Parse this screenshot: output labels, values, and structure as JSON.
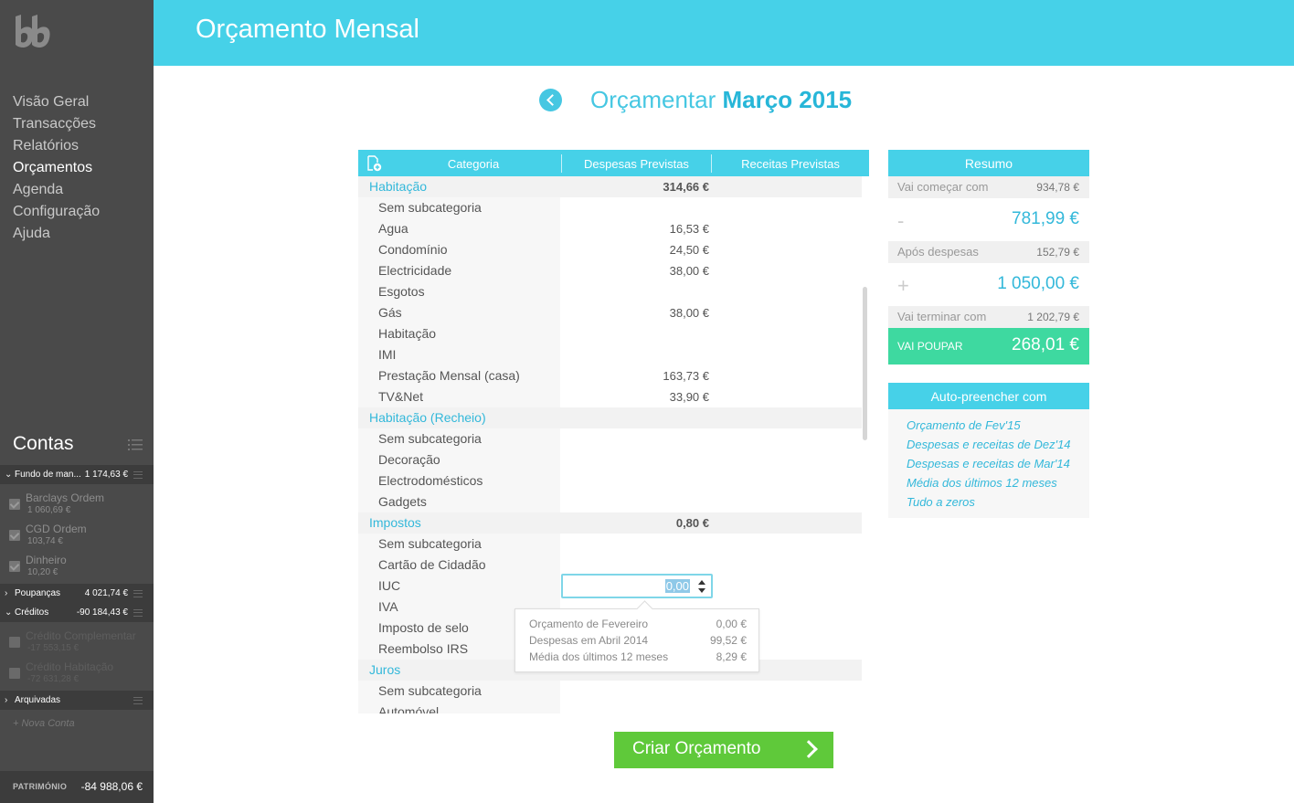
{
  "sidebar": {
    "nav": [
      "Visão Geral",
      "Transacções",
      "Relatórios",
      "Orçamentos",
      "Agenda",
      "Configuração",
      "Ajuda"
    ],
    "active_nav": "Orçamentos",
    "contas_title": "Contas",
    "groups": {
      "fundo": {
        "name": "Fundo de man...",
        "value": "1 174,63 €"
      },
      "poupancas": {
        "name": "Poupanças",
        "value": "4 021,74 €"
      },
      "creditos": {
        "name": "Créditos",
        "value": "-90 184,43 €"
      },
      "arquivadas": {
        "name": "Arquivadas"
      }
    },
    "fundo_accounts": [
      {
        "name": "Barclays Ordem",
        "value": "1 060,69 €"
      },
      {
        "name": "CGD Ordem",
        "value": "103,74 €"
      },
      {
        "name": "Dinheiro",
        "value": "10,20 €"
      }
    ],
    "credito_accounts": [
      {
        "name": "Crédito Complementar",
        "value": "-17 553,15 €"
      },
      {
        "name": "Crédito Habitação",
        "value": "-72 631,28 €"
      }
    ],
    "nova_conta": "+ Nova Conta",
    "patrimonio_label": "PATRIMÓNIO",
    "patrimonio_value": "-84 988,06 €"
  },
  "header": {
    "title": "Orçamento Mensal"
  },
  "month": {
    "prefix": "Orçamentar",
    "name": "Março 2015"
  },
  "table": {
    "headers": {
      "categoria": "Categoria",
      "despesas": "Despesas Previstas",
      "receitas": "Receitas Previstas"
    },
    "rows": [
      {
        "type": "cat",
        "name": "Habitação",
        "amount": "314,66 €"
      },
      {
        "type": "sub",
        "name": "Sem subcategoria",
        "amount": ""
      },
      {
        "type": "sub",
        "name": "Agua",
        "amount": "16,53 €"
      },
      {
        "type": "sub",
        "name": "Condomínio",
        "amount": "24,50 €"
      },
      {
        "type": "sub",
        "name": "Electricidade",
        "amount": "38,00 €"
      },
      {
        "type": "sub",
        "name": "Esgotos",
        "amount": ""
      },
      {
        "type": "sub",
        "name": "Gás",
        "amount": "38,00 €"
      },
      {
        "type": "sub",
        "name": "Habitação",
        "amount": ""
      },
      {
        "type": "sub",
        "name": "IMI",
        "amount": ""
      },
      {
        "type": "sub",
        "name": "Prestação Mensal (casa)",
        "amount": "163,73 €"
      },
      {
        "type": "sub",
        "name": "TV&Net",
        "amount": "33,90 €"
      },
      {
        "type": "cat",
        "name": "Habitação (Recheio)",
        "amount": ""
      },
      {
        "type": "sub",
        "name": "Sem subcategoria",
        "amount": ""
      },
      {
        "type": "sub",
        "name": "Decoração",
        "amount": ""
      },
      {
        "type": "sub",
        "name": "Electrodomésticos",
        "amount": ""
      },
      {
        "type": "sub",
        "name": "Gadgets",
        "amount": ""
      },
      {
        "type": "cat",
        "name": "Impostos",
        "amount": "0,80 €"
      },
      {
        "type": "sub",
        "name": "Sem subcategoria",
        "amount": ""
      },
      {
        "type": "sub",
        "name": "Cartão de Cidadão",
        "amount": ""
      },
      {
        "type": "sub",
        "name": "IUC",
        "amount": ""
      },
      {
        "type": "sub",
        "name": "IVA",
        "amount": ""
      },
      {
        "type": "sub",
        "name": "Imposto de selo",
        "amount": ""
      },
      {
        "type": "sub",
        "name": "Reembolso IRS",
        "amount": ""
      },
      {
        "type": "cat",
        "name": "Juros",
        "amount": ""
      },
      {
        "type": "sub",
        "name": "Sem subcategoria",
        "amount": ""
      },
      {
        "type": "sub",
        "name": "Automóvel",
        "amount": ""
      }
    ],
    "active_input_value": "0,00",
    "tooltip": [
      {
        "label": "Orçamento de Fevereiro",
        "value": "0,00 €"
      },
      {
        "label": "Despesas em Abril 2014",
        "value": "99,52 €"
      },
      {
        "label": "Média dos últimos 12 meses",
        "value": "8,29 €"
      }
    ]
  },
  "resumo": {
    "title": "Resumo",
    "start_label": "Vai começar com",
    "start_value": "934,78 €",
    "minus_sign": "-",
    "minus_value": "781,99 €",
    "after_label": "Após despesas",
    "after_value": "152,79 €",
    "plus_sign": "+",
    "plus_value": "1 050,00 €",
    "end_label": "Vai terminar com",
    "end_value": "1 202,79 €",
    "save_label": "VAI POUPAR",
    "save_value": "268,01 €"
  },
  "auto": {
    "title": "Auto-preencher com",
    "links": [
      "Orçamento de Fev'15",
      "Despesas e receitas de Dez'14",
      "Despesas e receitas de Mar'14",
      "Média dos últimos 12 meses",
      "Tudo a zeros"
    ]
  },
  "criar_label": "Criar Orçamento",
  "colors": {
    "accent": "#46d1e8",
    "save": "#3ed9a0",
    "button": "#5fc93a",
    "sidebar": "#4a4a4a"
  }
}
